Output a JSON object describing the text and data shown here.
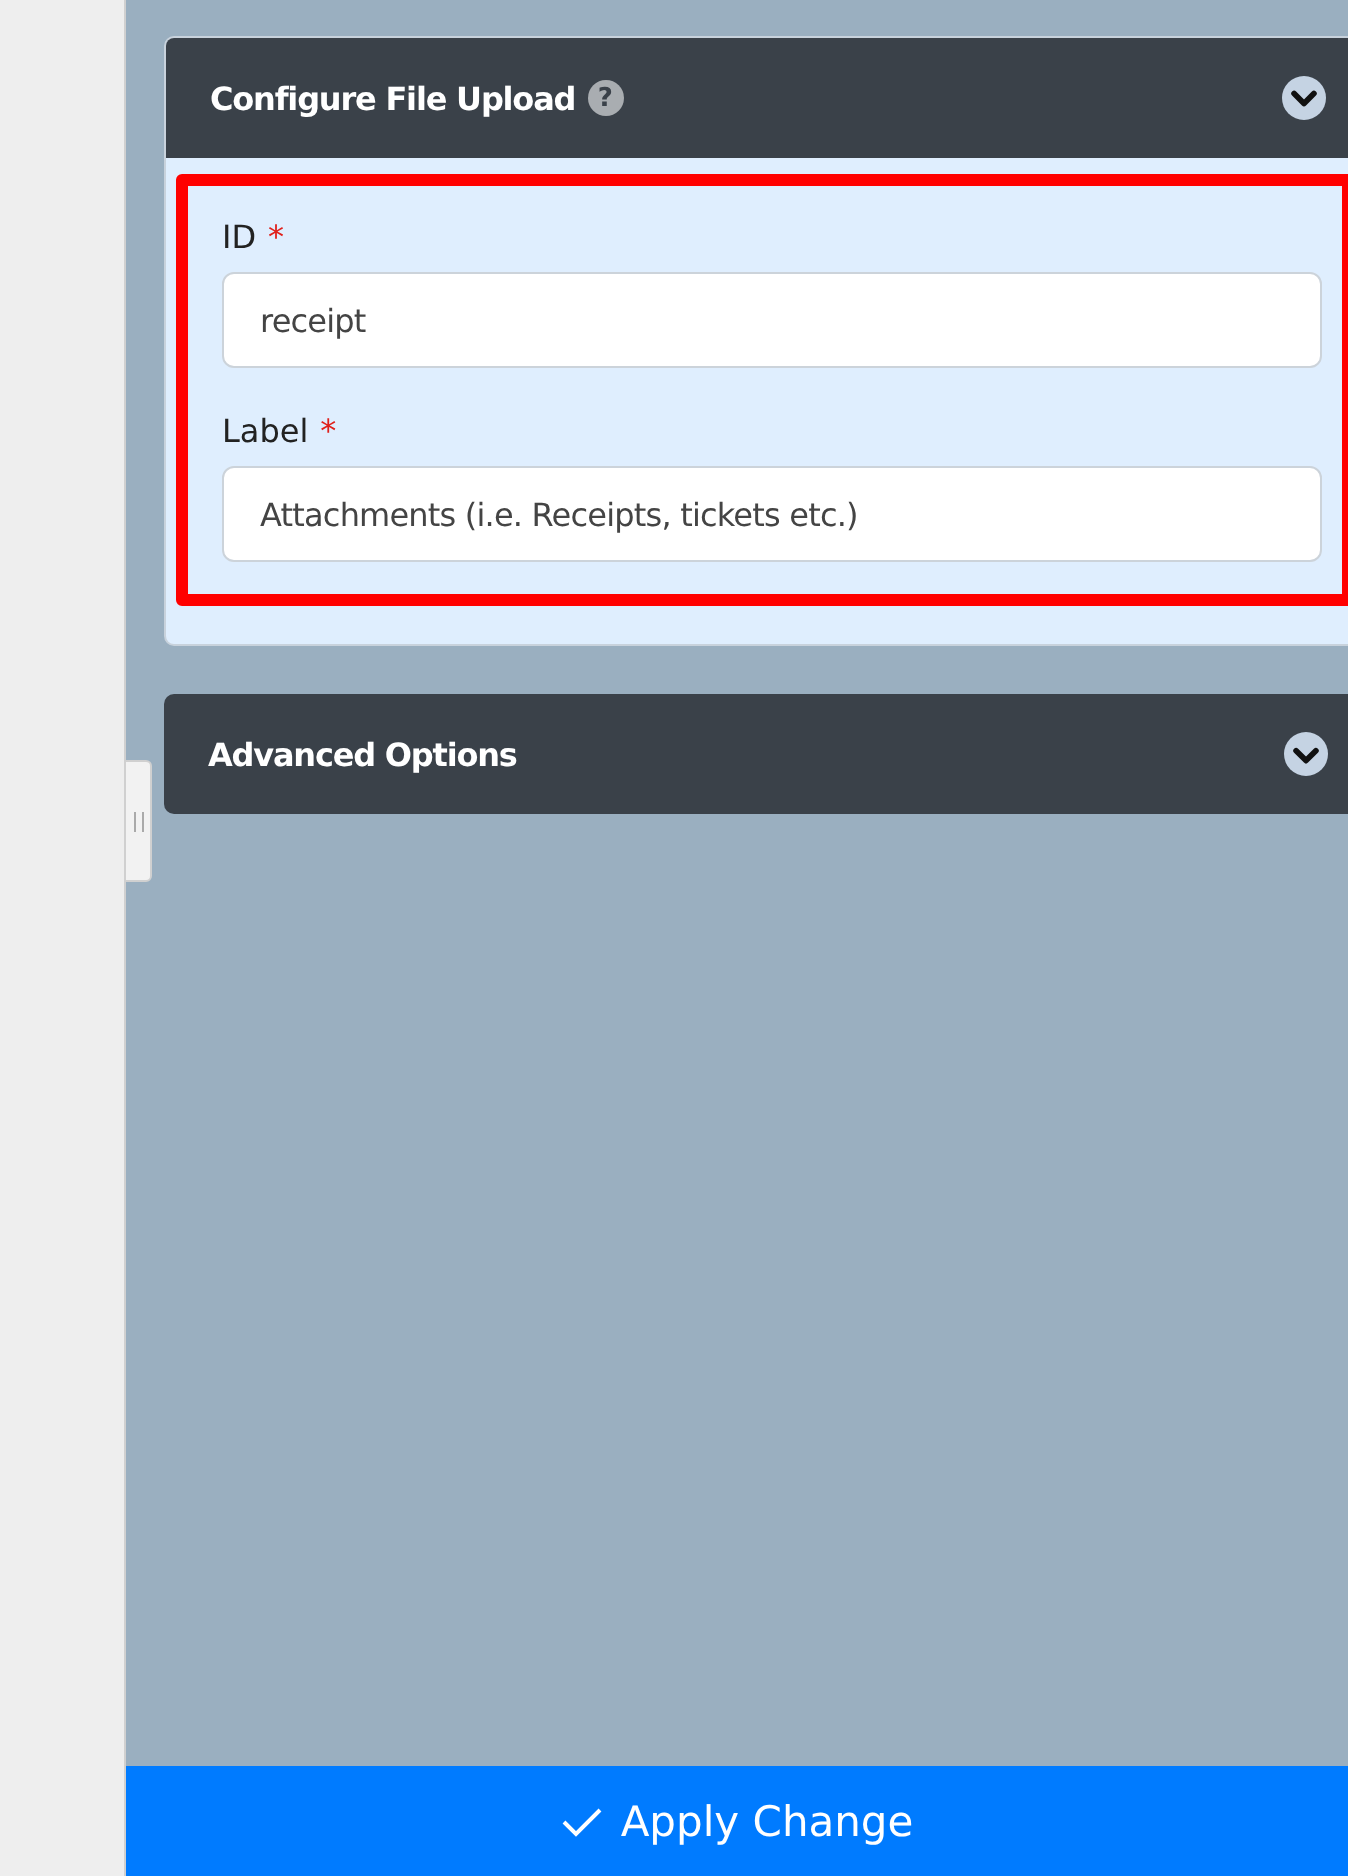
{
  "sections": [
    {
      "title": "Configure File Upload",
      "help": true,
      "expanded": true,
      "highlighted": true,
      "fields": [
        {
          "label": "ID",
          "required": true,
          "value": "receipt"
        },
        {
          "label": "Label",
          "required": true,
          "value": "Attachments (i.e. Receipts, tickets etc.)"
        }
      ]
    },
    {
      "title": "Advanced Options",
      "expanded": false
    }
  ],
  "required_mark": "*",
  "help_glyph": "?",
  "apply_button": {
    "label": "Apply Change"
  }
}
